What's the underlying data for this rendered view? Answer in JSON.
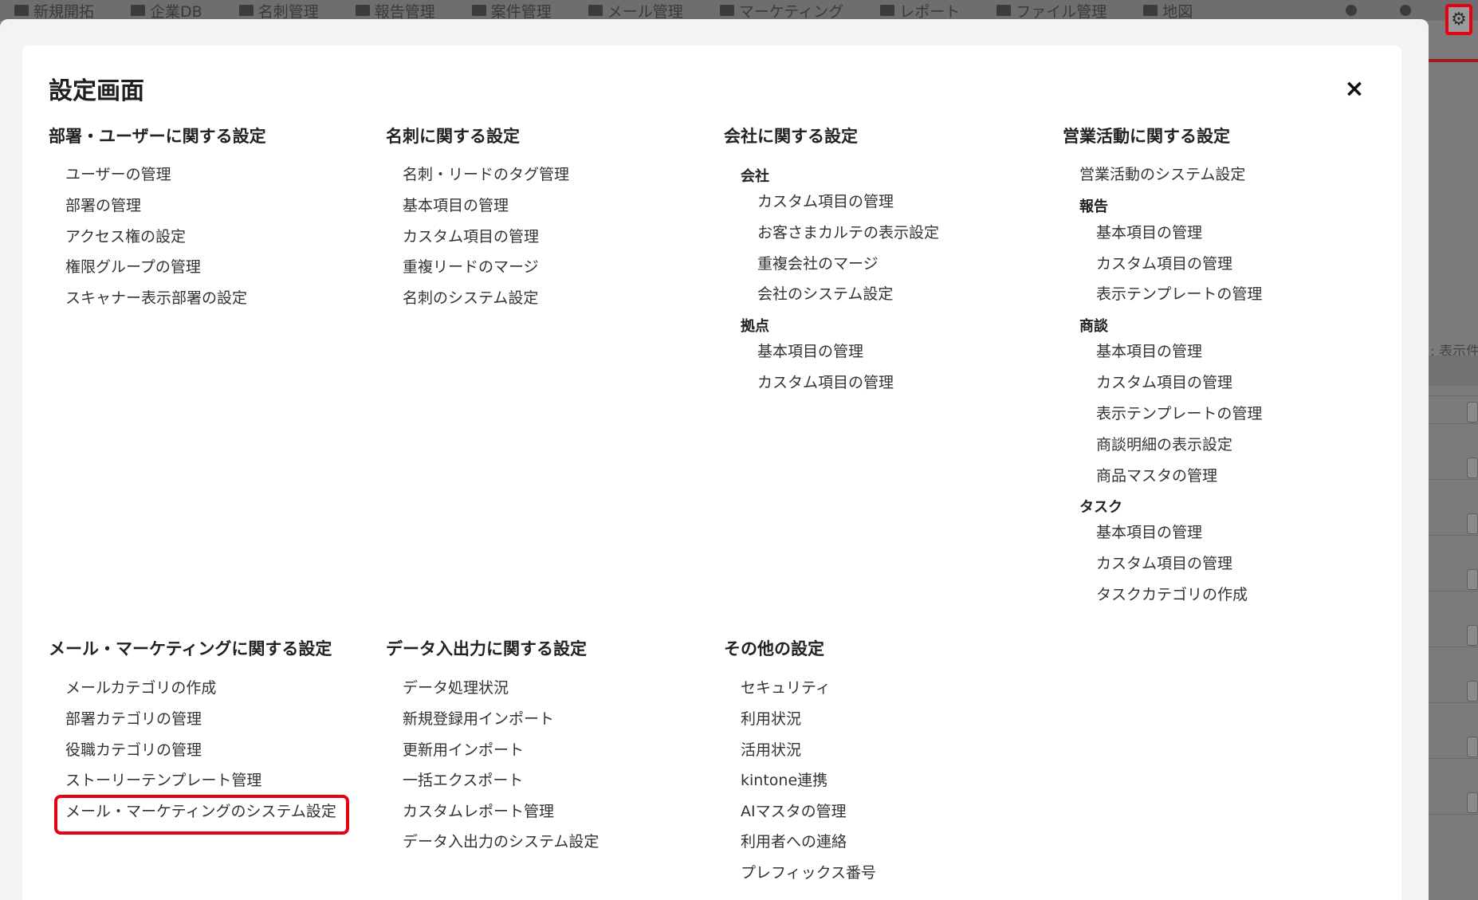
{
  "topbar": {
    "nav": [
      "新規開拓",
      "企業DB",
      "名刺管理",
      "報告管理",
      "案件管理",
      "メール管理",
      "マーケティング",
      "レポート",
      "ファイル管理",
      "地図"
    ],
    "settings_icon": "gear-icon"
  },
  "background": {
    "right_label": "表示件"
  },
  "modal": {
    "title": "設定画面",
    "close_label": "×",
    "sections": {
      "dept_user": {
        "title": "部署・ユーザーに関する設定",
        "items": [
          "ユーザーの管理",
          "部署の管理",
          "アクセス権の設定",
          "権限グループの管理",
          "スキャナー表示部署の設定"
        ]
      },
      "meishi": {
        "title": "名刺に関する設定",
        "items": [
          "名刺・リードのタグ管理",
          "基本項目の管理",
          "カスタム項目の管理",
          "重複リードのマージ",
          "名刺のシステム設定"
        ]
      },
      "company": {
        "title": "会社に関する設定",
        "group1": "会社",
        "group1_items": [
          "カスタム項目の管理",
          "お客さまカルテの表示設定",
          "重複会社のマージ",
          "会社のシステム設定"
        ],
        "group2": "拠点",
        "group2_items": [
          "基本項目の管理",
          "カスタム項目の管理"
        ]
      },
      "sales": {
        "title": "営業活動に関する設定",
        "top_item": "営業活動のシステム設定",
        "group1": "報告",
        "group1_items": [
          "基本項目の管理",
          "カスタム項目の管理",
          "表示テンプレートの管理"
        ],
        "group2": "商談",
        "group2_items": [
          "基本項目の管理",
          "カスタム項目の管理",
          "表示テンプレートの管理",
          "商談明細の表示設定",
          "商品マスタの管理"
        ],
        "group3": "タスク",
        "group3_items": [
          "基本項目の管理",
          "カスタム項目の管理",
          "タスクカテゴリの作成"
        ]
      },
      "mail": {
        "title": "メール・マーケティングに関する設定",
        "items": [
          "メールカテゴリの作成",
          "部署カテゴリの管理",
          "役職カテゴリの管理",
          "ストーリーテンプレート管理",
          "メール・マーケティングのシステム設定"
        ]
      },
      "data_io": {
        "title": "データ入出力に関する設定",
        "items": [
          "データ処理状況",
          "新規登録用インポート",
          "更新用インポート",
          "一括エクスポート",
          "カスタムレポート管理",
          "データ入出力のシステム設定"
        ]
      },
      "other": {
        "title": "その他の設定",
        "items": [
          "セキュリティ",
          "利用状況",
          "活用状況",
          "kintone連携",
          "AIマスタの管理",
          "利用者への連絡",
          "プレフィックス番号"
        ]
      }
    }
  }
}
